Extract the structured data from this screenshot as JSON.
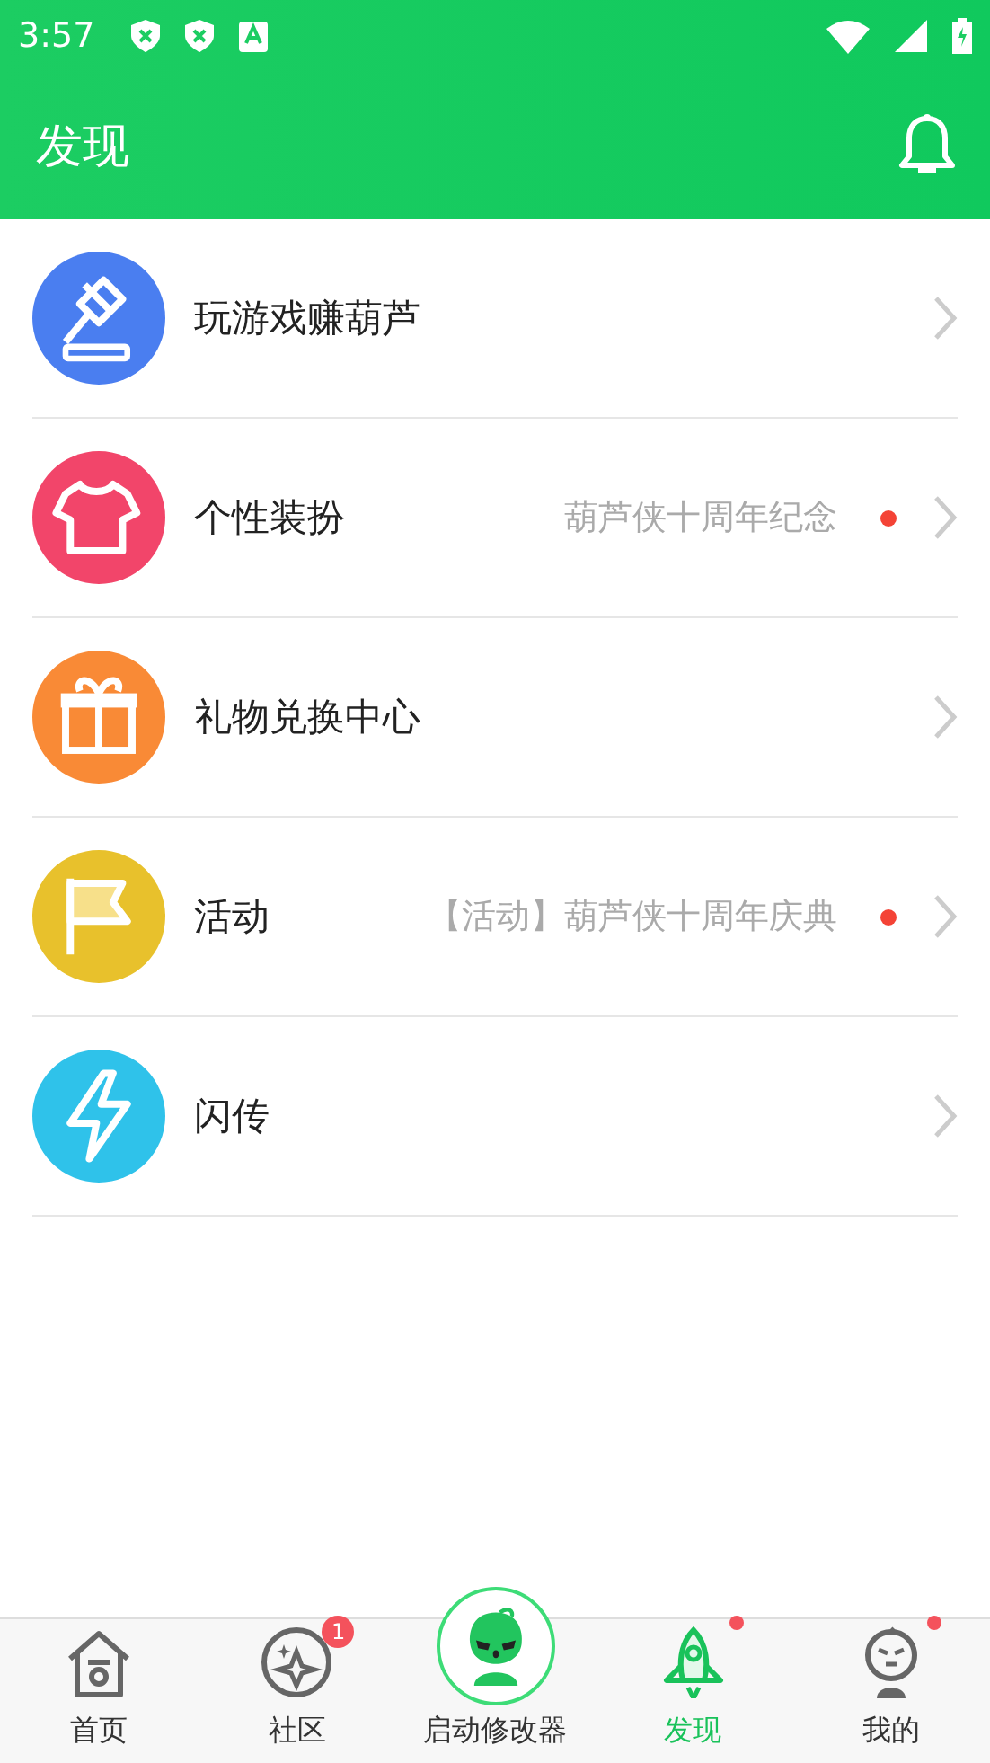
{
  "status_bar": {
    "time": "3:57"
  },
  "header": {
    "title": "发现"
  },
  "items": [
    {
      "kind": "gavel",
      "color": "#4a7ef0",
      "title": "玩游戏赚葫芦",
      "dot": false
    },
    {
      "kind": "shirt",
      "color": "#f2456a",
      "title": "个性装扮",
      "subtitle": "葫芦侠十周年纪念",
      "dot": true
    },
    {
      "kind": "gift",
      "color": "#f98a36",
      "title": "礼物兑换中心",
      "dot": false
    },
    {
      "kind": "flag",
      "color": "#e8c12c",
      "title": "活动",
      "subtitle": "【活动】葫芦侠十周年庆典",
      "dot": true
    },
    {
      "kind": "bolt",
      "color": "#2fc2ea",
      "title": "闪传",
      "dot": false
    }
  ],
  "nav": [
    {
      "kind": "home",
      "label": "首页",
      "selected": false,
      "dot": false
    },
    {
      "kind": "star",
      "label": "社区",
      "selected": false,
      "badge": "1",
      "dot": false
    },
    {
      "kind": "launch",
      "label": "启动修改器",
      "selected": false,
      "dot": false
    },
    {
      "kind": "rocket",
      "label": "发现",
      "selected": true,
      "dot": true
    },
    {
      "kind": "face",
      "label": "我的",
      "selected": false,
      "dot": true
    }
  ]
}
